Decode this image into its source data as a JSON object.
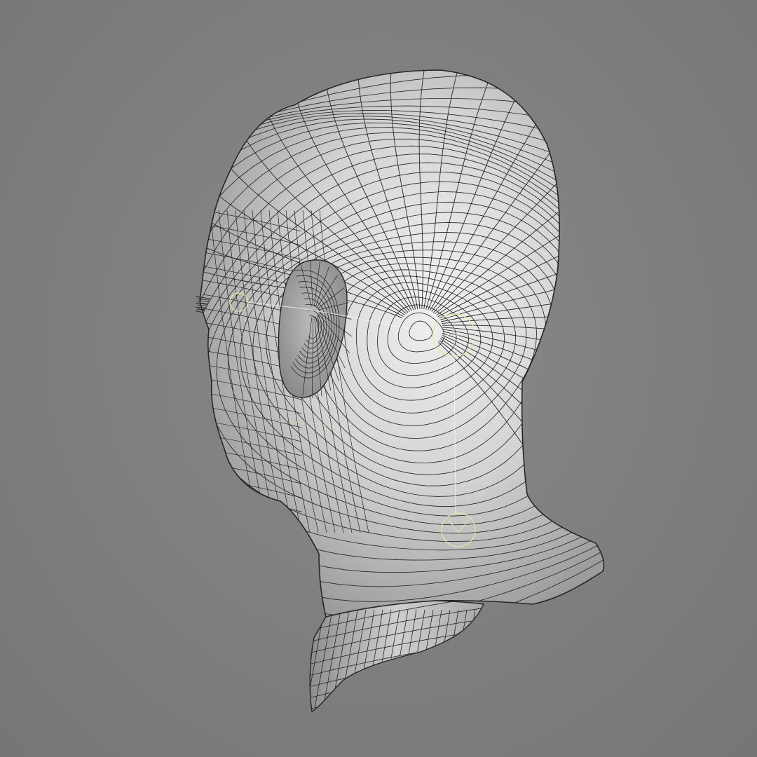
{
  "viewport": {
    "background_color": "#808080",
    "mesh_fill_color": "#cfcfcf",
    "mesh_highlight_color": "#eeeeee",
    "mesh_shadow_color": "#8f8f8f",
    "wire_color": "#262626",
    "rig_color": "#e4e8a0",
    "rig_line_color": "#f2f2f2"
  },
  "model": {
    "subject": "head-and-neck-wireframe-mesh",
    "view": "rear-three-quarter-left",
    "rig_controls": {
      "circle_count": 3,
      "helper_line_count": 2
    }
  }
}
